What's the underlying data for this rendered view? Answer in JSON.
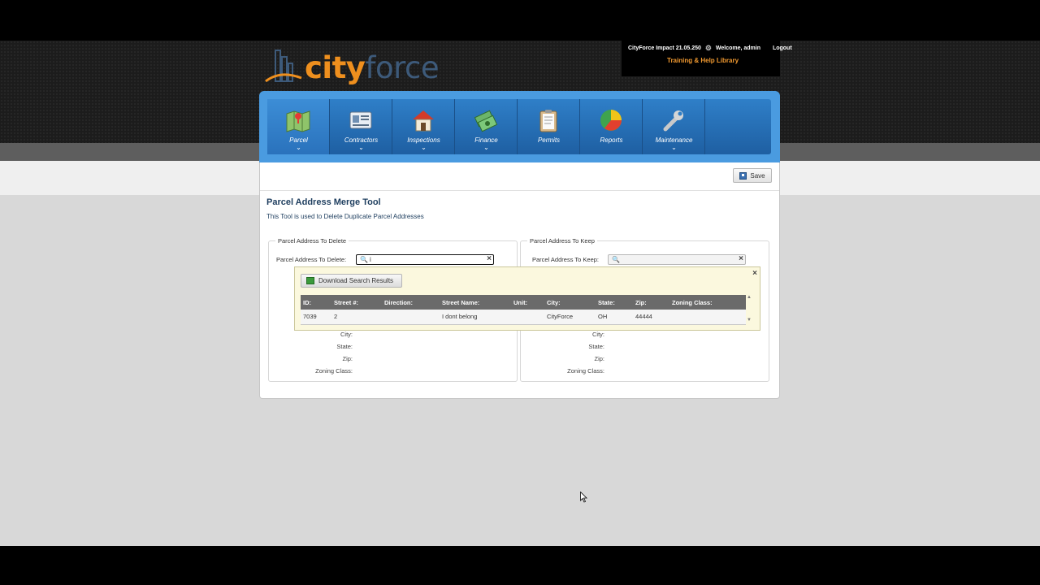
{
  "app": {
    "logo_city": "city",
    "logo_force": "force",
    "version_text": "CityForce Impact 21.05.250",
    "welcome_text": "Welcome, admin",
    "logout_label": "Logout",
    "training_link": "Training & Help Library"
  },
  "nav": {
    "items": [
      {
        "label": "Parcel",
        "icon": "map-icon",
        "has_menu": true
      },
      {
        "label": "Contractors",
        "icon": "id-card-icon",
        "has_menu": true
      },
      {
        "label": "Inspections",
        "icon": "house-icon",
        "has_menu": true
      },
      {
        "label": "Finance",
        "icon": "money-icon",
        "has_menu": true
      },
      {
        "label": "Permits",
        "icon": "clipboard-icon",
        "has_menu": false
      },
      {
        "label": "Reports",
        "icon": "pie-chart-icon",
        "has_menu": false
      },
      {
        "label": "Maintenance",
        "icon": "wrench-icon",
        "has_menu": true
      }
    ],
    "active": "Parcel",
    "caret": "⌄"
  },
  "toolbar": {
    "save_label": "Save"
  },
  "page": {
    "title": "Parcel Address Merge Tool",
    "subtitle": "This Tool is used to Delete Duplicate Parcel Addresses"
  },
  "delete_group": {
    "legend": "Parcel Address To Delete",
    "search_label": "Parcel Address To Delete:",
    "search_value": "i",
    "city_label": "City:",
    "state_label": "State:",
    "zip_label": "Zip:",
    "zoning_label": "Zoning Class:"
  },
  "keep_group": {
    "legend": "Parcel Address To Keep",
    "search_label": "Parcel Address To Keep:",
    "search_value": "",
    "city_label": "City:",
    "state_label": "State:",
    "zip_label": "Zip:",
    "zoning_label": "Zoning Class:"
  },
  "results": {
    "download_label": "Download Search Results",
    "columns": [
      "ID:",
      "Street #:",
      "Direction:",
      "Street Name:",
      "Unit:",
      "City:",
      "State:",
      "Zip:",
      "Zoning Class:"
    ],
    "rows": [
      [
        "7039",
        "2",
        "",
        "I dont belong",
        "",
        "CityForce",
        "OH",
        "44444",
        ""
      ]
    ]
  },
  "colors": {
    "accent_orange": "#ee8f1e",
    "nav_blue": "#2f7fc8",
    "title_navy": "#1d3d5e",
    "results_bg": "#fbf8de"
  }
}
